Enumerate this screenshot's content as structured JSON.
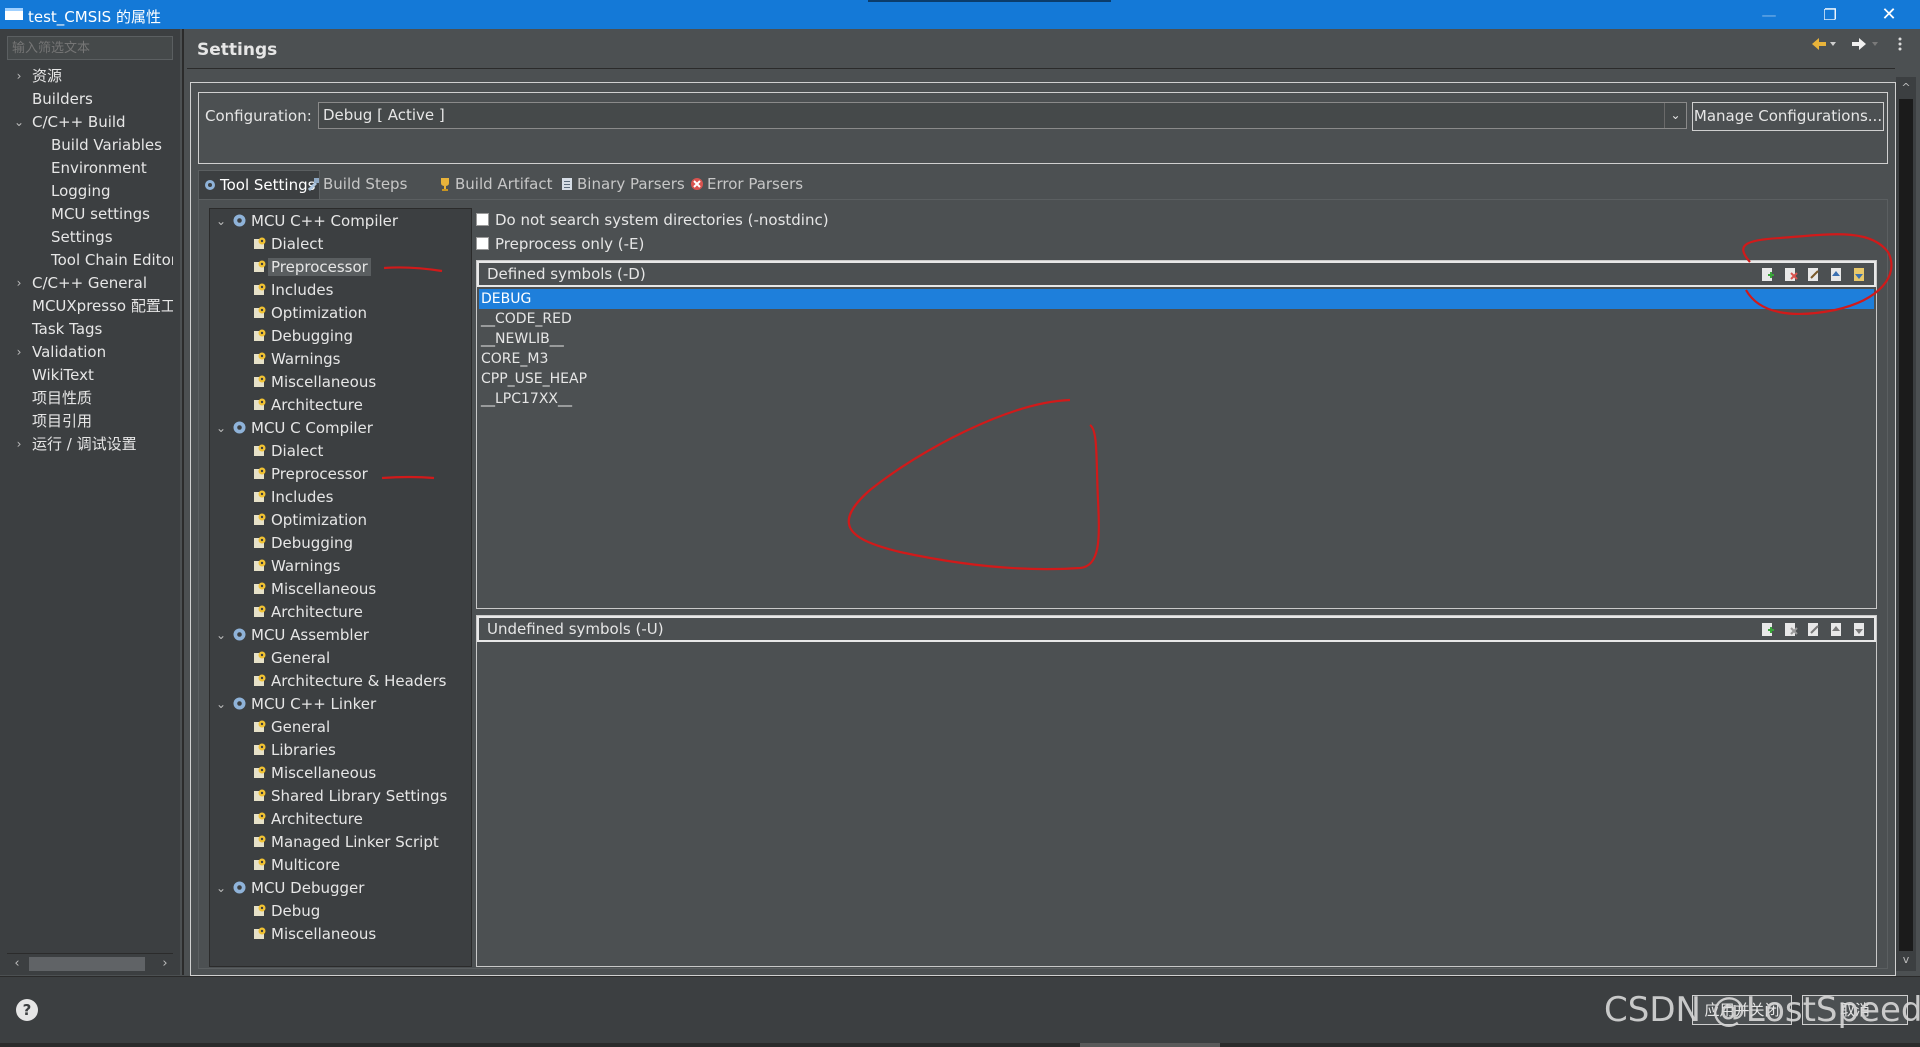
{
  "window": {
    "title": "test_CMSIS 的属性",
    "minimize_glyph": "—",
    "maximize_glyph": "❐",
    "close_glyph": "✕"
  },
  "left_nav": {
    "filter_placeholder": "输入筛选文本",
    "items": [
      {
        "label": "资源",
        "arrow": "›"
      },
      {
        "label": "Builders",
        "arrow": ""
      },
      {
        "label": "C/C++ Build",
        "arrow": "⌄"
      },
      {
        "label": "Build Variables",
        "arrow": ""
      },
      {
        "label": "Environment",
        "arrow": ""
      },
      {
        "label": "Logging",
        "arrow": ""
      },
      {
        "label": "MCU settings",
        "arrow": ""
      },
      {
        "label": "Settings",
        "arrow": ""
      },
      {
        "label": "Tool Chain Editor",
        "arrow": ""
      },
      {
        "label": "C/C++ General",
        "arrow": "›"
      },
      {
        "label": "MCUXpresso 配置工具",
        "arrow": ""
      },
      {
        "label": "Task Tags",
        "arrow": ""
      },
      {
        "label": "Validation",
        "arrow": "›"
      },
      {
        "label": "WikiText",
        "arrow": ""
      },
      {
        "label": "项目性质",
        "arrow": ""
      },
      {
        "label": "项目引用",
        "arrow": ""
      },
      {
        "label": "运行 / 调试设置",
        "arrow": "›"
      }
    ]
  },
  "header": {
    "title": "Settings"
  },
  "configuration": {
    "label": "Configuration:",
    "value": "Debug  [ Active ]",
    "manage_button": "Manage Configurations..."
  },
  "tabs": [
    {
      "label": "Tool Settings"
    },
    {
      "label": "Build Steps"
    },
    {
      "label": "Build Artifact"
    },
    {
      "label": "Binary Parsers"
    },
    {
      "label": "Error Parsers"
    }
  ],
  "tool_tree": {
    "groups": [
      {
        "label": "MCU C++ Compiler",
        "arrow": "⌄",
        "children": [
          "Dialect",
          "Preprocessor",
          "Includes",
          "Optimization",
          "Debugging",
          "Warnings",
          "Miscellaneous",
          "Architecture"
        ]
      },
      {
        "label": "MCU C Compiler",
        "arrow": "⌄",
        "children": [
          "Dialect",
          "Preprocessor",
          "Includes",
          "Optimization",
          "Debugging",
          "Warnings",
          "Miscellaneous",
          "Architecture"
        ]
      },
      {
        "label": "MCU Assembler",
        "arrow": "⌄",
        "children": [
          "General",
          "Architecture & Headers"
        ]
      },
      {
        "label": "MCU C++ Linker",
        "arrow": "⌄",
        "children": [
          "General",
          "Libraries",
          "Miscellaneous",
          "Shared Library Settings",
          "Architecture",
          "Managed Linker Script",
          "Multicore"
        ]
      },
      {
        "label": "MCU Debugger",
        "arrow": "⌄",
        "children": [
          "Debug",
          "Miscellaneous"
        ]
      }
    ]
  },
  "options": {
    "nostdinc": {
      "label": "Do not search system directories (-nostdinc)",
      "checked": false
    },
    "preprocess_only": {
      "label": "Preprocess only (-E)",
      "checked": false
    }
  },
  "defined_symbols": {
    "title": "Defined symbols (-D)",
    "items": [
      "DEBUG",
      "__CODE_RED",
      "__NEWLIB__",
      "CORE_M3",
      "CPP_USE_HEAP",
      "__LPC17XX__"
    ]
  },
  "undefined_symbols": {
    "title": "Undefined symbols (-U)",
    "items": []
  },
  "footer": {
    "help_glyph": "?",
    "apply_close_button": "应用并关闭",
    "cancel_button": "取消",
    "watermark": "CSDN @LostSpeed"
  },
  "colors": {
    "titlebar": "#1479d7",
    "selection": "#1e7fdb",
    "annotation": "#d11a1a"
  }
}
